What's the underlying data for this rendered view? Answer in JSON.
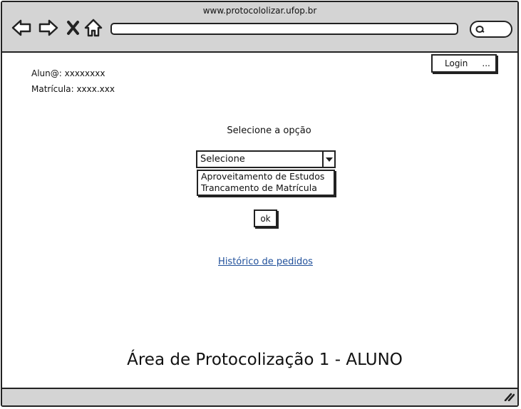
{
  "browser": {
    "url": "www.protocololizar.ufop.br",
    "icons": [
      "back-arrow-icon",
      "forward-arrow-icon",
      "close-x-icon",
      "home-icon",
      "search-icon"
    ]
  },
  "header": {
    "login_label": "Login",
    "login_dots": "..."
  },
  "student": {
    "aluno_label": "Alun@:",
    "aluno_value": "xxxxxxxx",
    "matricula_label": "Matrícula:",
    "matricula_value": "xxxx.xxx"
  },
  "form": {
    "prompt": "Selecione a opção",
    "select_value": "Selecione",
    "options": [
      "Aproveitamento de Estudos",
      "Trancamento de Matrícula"
    ],
    "ok_label": "ok"
  },
  "links": {
    "history": "Histórico de pedidos"
  },
  "page": {
    "heading": "Área de Protocolização 1 - ALUNO"
  },
  "colors": {
    "chrome_gray": "#d4d4d4",
    "border": "#222222",
    "link_blue": "#1f4f9a"
  }
}
